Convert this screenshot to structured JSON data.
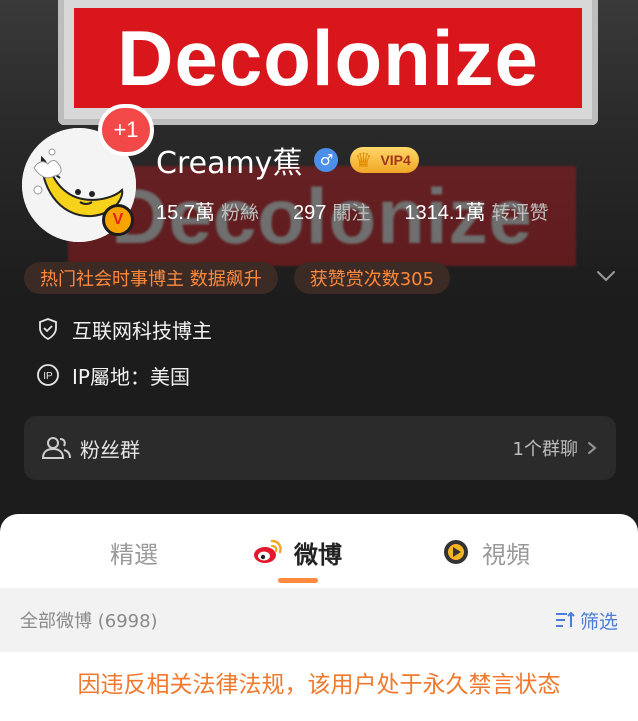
{
  "cover": {
    "banner_text": "Decolonize"
  },
  "avatar": {
    "badge_plus": "+1",
    "verify_letter": "V"
  },
  "profile": {
    "name": "Creamy蕉",
    "gender_symbol": "♂",
    "vip_label": "VIP4",
    "stats": [
      {
        "num": "15.7萬",
        "label": "粉絲"
      },
      {
        "num": "297",
        "label": "關注"
      },
      {
        "num": "1314.1萬",
        "label": "转评赞"
      }
    ]
  },
  "tags": [
    "热门社会时事博主 数据飙升",
    "获赞赏次数305"
  ],
  "info": {
    "category": "互联网科技博主",
    "ip_label": "IP屬地：美国"
  },
  "fan_group": {
    "title": "粉丝群",
    "count": "1个群聊"
  },
  "tabs": [
    {
      "label": "精選",
      "active": false
    },
    {
      "label": "微博",
      "active": true
    },
    {
      "label": "視頻",
      "active": false
    }
  ],
  "filter": {
    "all_posts": "全部微博 (6998)",
    "filter_label": "筛选"
  },
  "ban_message": "因违反相关法律法规，该用户处于永久禁言状态",
  "colors": {
    "accent": "#ff8a3d",
    "link": "#4a7ed6",
    "ban_text": "#f0792e",
    "cover_red": "#d8161c"
  }
}
